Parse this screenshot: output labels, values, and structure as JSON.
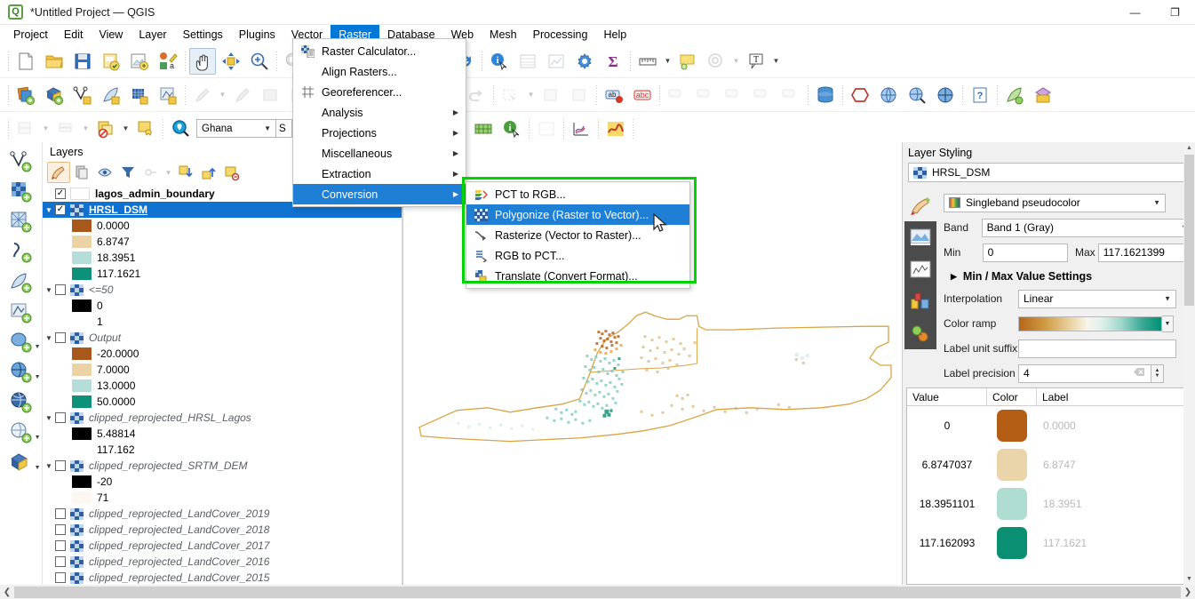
{
  "window": {
    "title": "*Untitled Project — QGIS",
    "logo_letter": "Q",
    "minimize": "—",
    "restore": "❐",
    "collapse_ribbon": "^"
  },
  "menubar": {
    "items": [
      {
        "label": "Project",
        "active": false
      },
      {
        "label": "Edit",
        "active": false
      },
      {
        "label": "View",
        "active": false
      },
      {
        "label": "Layer",
        "active": false
      },
      {
        "label": "Settings",
        "active": false
      },
      {
        "label": "Plugins",
        "active": false
      },
      {
        "label": "Vector",
        "active": false
      },
      {
        "label": "Raster",
        "active": true
      },
      {
        "label": "Database",
        "active": false
      },
      {
        "label": "Web",
        "active": false
      },
      {
        "label": "Mesh",
        "active": false
      },
      {
        "label": "Processing",
        "active": false
      },
      {
        "label": "Help",
        "active": false
      }
    ]
  },
  "raster_menu": {
    "items": [
      {
        "label": "Raster Calculator...",
        "icon": "raster-calculator-icon",
        "submenu": false,
        "selected": false
      },
      {
        "label": "Align Rasters...",
        "icon": "align-rasters-icon",
        "submenu": false,
        "selected": false
      },
      {
        "label": "Georeferencer...",
        "icon": "georeferencer-icon",
        "submenu": false,
        "selected": false
      },
      {
        "label": "Analysis",
        "icon": "none",
        "submenu": true,
        "selected": false
      },
      {
        "label": "Projections",
        "icon": "none",
        "submenu": true,
        "selected": false
      },
      {
        "label": "Miscellaneous",
        "icon": "none",
        "submenu": true,
        "selected": false
      },
      {
        "label": "Extraction",
        "icon": "none",
        "submenu": true,
        "selected": false
      },
      {
        "label": "Conversion",
        "icon": "none",
        "submenu": true,
        "selected": true
      }
    ],
    "submenu_arrow": "▶"
  },
  "conversion_submenu": {
    "highlight_color": "#00d400",
    "items": [
      {
        "label": "PCT to RGB...",
        "icon": "pct-to-rgb-icon",
        "selected": false
      },
      {
        "label": "Polygonize (Raster to Vector)...",
        "icon": "polygonize-icon",
        "selected": true
      },
      {
        "label": "Rasterize (Vector to Raster)...",
        "icon": "rasterize-icon",
        "selected": false
      },
      {
        "label": "RGB to PCT...",
        "icon": "rgb-to-pct-icon",
        "selected": false
      },
      {
        "label": "Translate (Convert Format)...",
        "icon": "translate-icon",
        "selected": false
      }
    ]
  },
  "toolbar": {
    "crs_value": "Ghana",
    "crs_partial": "S",
    "row1_icons": [
      "new-project-icon",
      "open-project-icon",
      "save-project-icon",
      "save-as-icon",
      "new-print-layout-icon",
      "style-manager-icon",
      "pan-map-icon",
      "pan-to-selection-icon",
      "zoom-in-icon"
    ],
    "row2_icons": [
      "add-group-icon",
      "manage-layers-icon",
      "add-vertex-icon",
      "edit-pencil-icon",
      "digitize-icon",
      "vertex-tool-icon"
    ],
    "row3_icons": [
      "attributes-icon",
      "copy-features-icon",
      "select-features-icon",
      "deselect-icon",
      "identify-features-icon"
    ]
  },
  "layers_panel": {
    "title": "Layers",
    "toolbar_icons": [
      "open-styling-panel-icon",
      "add-group-icon",
      "manage-visibility-icon",
      "filter-legend-icon",
      "filter-expression-icon",
      "expand-all-icon",
      "collapse-all-icon",
      "remove-layer-icon"
    ],
    "tree": [
      {
        "type": "layer",
        "label": "lagos_admin_boundary",
        "checked": true,
        "expander": "",
        "indent": 1,
        "style": "bold",
        "icon": "vector-polygon-icon",
        "swatch": "#fdfdfd"
      },
      {
        "type": "layer",
        "label": "HRSL_DSM",
        "checked": true,
        "expander": "▼",
        "indent": 0,
        "style": "selected",
        "icon": "raster-icon"
      },
      {
        "type": "legend",
        "label": "0.0000",
        "swatch": "#a8581a",
        "indent": 2
      },
      {
        "type": "legend",
        "label": "6.8747",
        "swatch": "#ecd3a6",
        "indent": 2
      },
      {
        "type": "legend",
        "label": "18.3951",
        "swatch": "#b5ded8",
        "indent": 2
      },
      {
        "type": "legend",
        "label": "117.1621",
        "swatch": "#0e9179",
        "indent": 2
      },
      {
        "type": "layer",
        "label": "<=50",
        "checked": false,
        "expander": "▼",
        "indent": 0,
        "style": "italic",
        "icon": "raster-icon"
      },
      {
        "type": "legend",
        "label": "0",
        "swatch": "#000000",
        "indent": 2
      },
      {
        "type": "legend",
        "label": "1",
        "swatch": "#ffffff",
        "indent": 2
      },
      {
        "type": "layer",
        "label": "Output",
        "checked": false,
        "expander": "▼",
        "indent": 0,
        "style": "italic",
        "icon": "raster-icon"
      },
      {
        "type": "legend",
        "label": "-20.0000",
        "swatch": "#a8581a",
        "indent": 2
      },
      {
        "type": "legend",
        "label": "7.0000",
        "swatch": "#ecd3a6",
        "indent": 2
      },
      {
        "type": "legend",
        "label": "13.0000",
        "swatch": "#b5ded8",
        "indent": 2
      },
      {
        "type": "legend",
        "label": "50.0000",
        "swatch": "#0e9179",
        "indent": 2
      },
      {
        "type": "layer",
        "label": "clipped_reprojected_HRSL_Lagos",
        "checked": false,
        "expander": "▼",
        "indent": 0,
        "style": "italic",
        "icon": "raster-icon"
      },
      {
        "type": "legend",
        "label": "5.48814",
        "swatch": "#000000",
        "indent": 2
      },
      {
        "type": "legend",
        "label": "117.162",
        "swatch": "#ffffff",
        "indent": 2
      },
      {
        "type": "layer",
        "label": "clipped_reprojected_SRTM_DEM",
        "checked": false,
        "expander": "▼",
        "indent": 0,
        "style": "italic",
        "icon": "raster-icon"
      },
      {
        "type": "legend",
        "label": "-20",
        "swatch": "#000000",
        "indent": 2
      },
      {
        "type": "legend",
        "label": "71",
        "swatch": "#fdf8ef",
        "indent": 2
      },
      {
        "type": "layer",
        "label": "clipped_reprojected_LandCover_2019",
        "checked": false,
        "expander": "",
        "indent": 1,
        "style": "italic",
        "icon": "raster-icon"
      },
      {
        "type": "layer",
        "label": "clipped_reprojected_LandCover_2018",
        "checked": false,
        "expander": "",
        "indent": 1,
        "style": "italic",
        "icon": "raster-icon"
      },
      {
        "type": "layer",
        "label": "clipped_reprojected_LandCover_2017",
        "checked": false,
        "expander": "",
        "indent": 1,
        "style": "italic",
        "icon": "raster-icon"
      },
      {
        "type": "layer",
        "label": "clipped_reprojected_LandCover_2016",
        "checked": false,
        "expander": "",
        "indent": 1,
        "style": "italic",
        "icon": "raster-icon"
      },
      {
        "type": "layer",
        "label": "clipped_reprojected_LandCover_2015",
        "checked": false,
        "expander": "",
        "indent": 1,
        "style": "italic",
        "icon": "raster-icon"
      }
    ]
  },
  "styling_panel": {
    "title": "Layer Styling",
    "layer_name": "HRSL_DSM",
    "renderer": "Singleband pseudocolor",
    "band_label": "Band",
    "band_value": "Band 1 (Gray)",
    "min_label": "Min",
    "min_value": "0",
    "max_label": "Max",
    "max_value": "117.1621399",
    "minmax_section": "Min / Max Value Settings",
    "interpolation_label": "Interpolation",
    "interpolation_value": "Linear",
    "colorramp_label": "Color ramp",
    "label_unit_suffix_label": "Label unit suffix",
    "label_unit_suffix_value": "",
    "label_precision_label": "Label precision",
    "label_precision_value": "4",
    "table": {
      "headers": [
        "Value",
        "Color",
        "Label"
      ],
      "rows": [
        {
          "value": "0",
          "color": "#b35e14",
          "label": "0.0000"
        },
        {
          "value": "6.8747037",
          "color": "#ead5ab",
          "label": "6.8747"
        },
        {
          "value": "18.3951101",
          "color": "#b0ddd1",
          "label": "18.3951"
        },
        {
          "value": "117.162093",
          "color": "#0b8f72",
          "label": "117.1621"
        }
      ]
    }
  },
  "map": {
    "boundary_color": "#d9a441",
    "background": "#ffffff"
  }
}
